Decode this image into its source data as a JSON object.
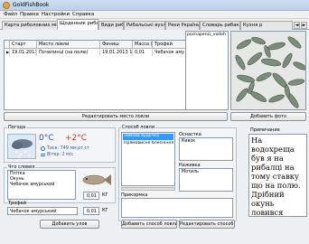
{
  "window": {
    "title": "GoldFishBook"
  },
  "menu": [
    "Файл",
    "Правка",
    "Настройки",
    "Справка"
  ],
  "tabs": [
    {
      "label": "Карта риболовних місць",
      "active": false
    },
    {
      "label": "Щоденник рибака",
      "active": true
    },
    {
      "label": "Види риб",
      "active": false
    },
    {
      "label": "Рибальські вузлі",
      "active": false
    },
    {
      "label": "Реки України",
      "active": false
    },
    {
      "label": "Словарь рибака",
      "active": false
    },
    {
      "label": "Кухня р",
      "active": false
    }
  ],
  "tab_scroll": {
    "left": "◄",
    "right": "►"
  },
  "table": {
    "headers": [
      "Старт",
      "Место ловли",
      "Финиш",
      "Масса (кг)",
      "Трофей"
    ],
    "rows": [
      [
        "19.01.2013 13",
        "Почапинці (на полю)",
        "19.01.2013 1",
        "0,01",
        "Чебачок аму"
      ]
    ]
  },
  "photo_list": {
    "items": [
      "pochapenci_vodoh"
    ]
  },
  "buttons": {
    "edit_place": "Редактировать место ловли",
    "add_photo": "Добавить фото",
    "add_catch": "Добавить улов",
    "add_method": "Добавить способ ловли",
    "edit_method": "Редактировать способ ловли"
  },
  "weather": {
    "legend": "Погода",
    "temp_water": "0°C",
    "temp_air": "+2°C",
    "pressure": "Тиск: 749 мм.рт.ст",
    "wind": "Вітер: 2 м/с"
  },
  "catch": {
    "legend": "Что словил",
    "items": [
      "Плітка",
      "Окунь",
      "Чебачок амурський"
    ],
    "weight": "0,01",
    "unit": "КГ"
  },
  "trophy": {
    "legend": "Трофей",
    "value": "Чебачок амурський",
    "weight": "0,01",
    "unit": "КГ"
  },
  "method": {
    "legend": "Способ ловли",
    "items": [
      {
        "label": "Зимова вудочка",
        "selected": true
      },
      {
        "label": "Прямовисне блесніння",
        "selected": false
      }
    ]
  },
  "gear": {
    "snap_label": "Оснастка",
    "snap_value": "Кивок",
    "bait_label": "Наживка",
    "bait_value": "Мотиль",
    "groundbait_label": "Прикормка"
  },
  "note": {
    "legend": "Примечание",
    "text": "На водохреща був я на рибалці на тому ставку що на полю. Дрібний окунь ловився постійно. Плотва ловилася моментами."
  },
  "colors": {
    "selection": "#3399ff",
    "accent": "#3b6ea5"
  }
}
